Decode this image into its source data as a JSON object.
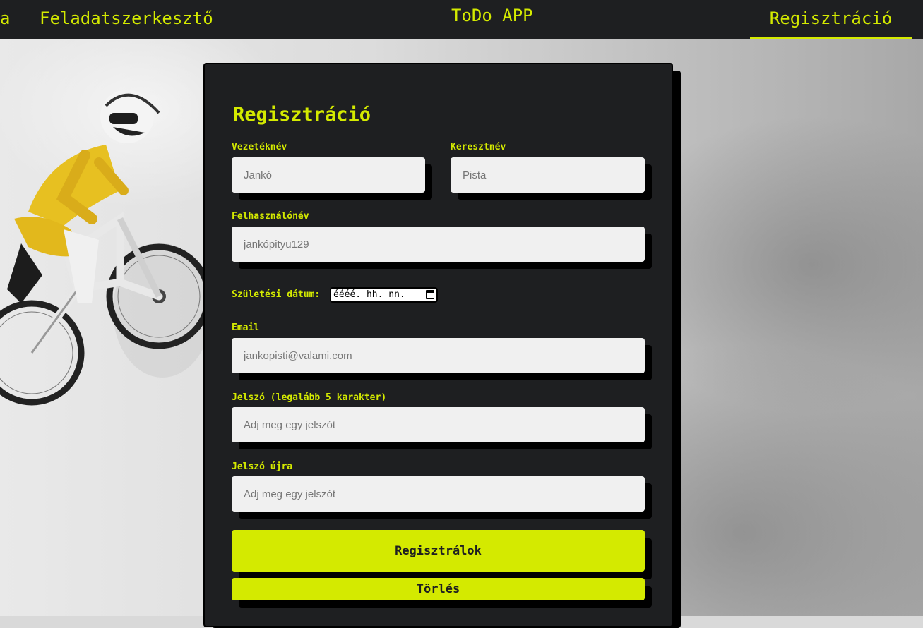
{
  "nav": {
    "clipped_item": "a",
    "editor": "Feladatszerkesztő",
    "brand": "ToDo APP",
    "register": "Regisztráció"
  },
  "form": {
    "title": "Regisztráció",
    "last_name": {
      "label": "Vezetéknév",
      "placeholder": "Jankó"
    },
    "first_name": {
      "label": "Keresztnév",
      "placeholder": "Pista"
    },
    "username": {
      "label": "Felhasználónév",
      "placeholder": "jankópityu129"
    },
    "birth_date": {
      "label": "Születési dátum:",
      "placeholder": "éééé. hh. nn."
    },
    "email": {
      "label": "Email",
      "placeholder": "jankopisti@valami.com"
    },
    "password": {
      "label": "Jelszó (legalább 5 karakter)",
      "placeholder": "Adj meg egy jelszót"
    },
    "password_again": {
      "label": "Jelszó újra",
      "placeholder": "Adj meg egy jelszót"
    },
    "submit_label": "Regisztrálok",
    "clear_label": "Törlés"
  },
  "colors": {
    "accent": "#d4ea00",
    "panel": "#1e1f21",
    "input": "#f0f0f0"
  },
  "icons": [
    "calendar-icon"
  ]
}
